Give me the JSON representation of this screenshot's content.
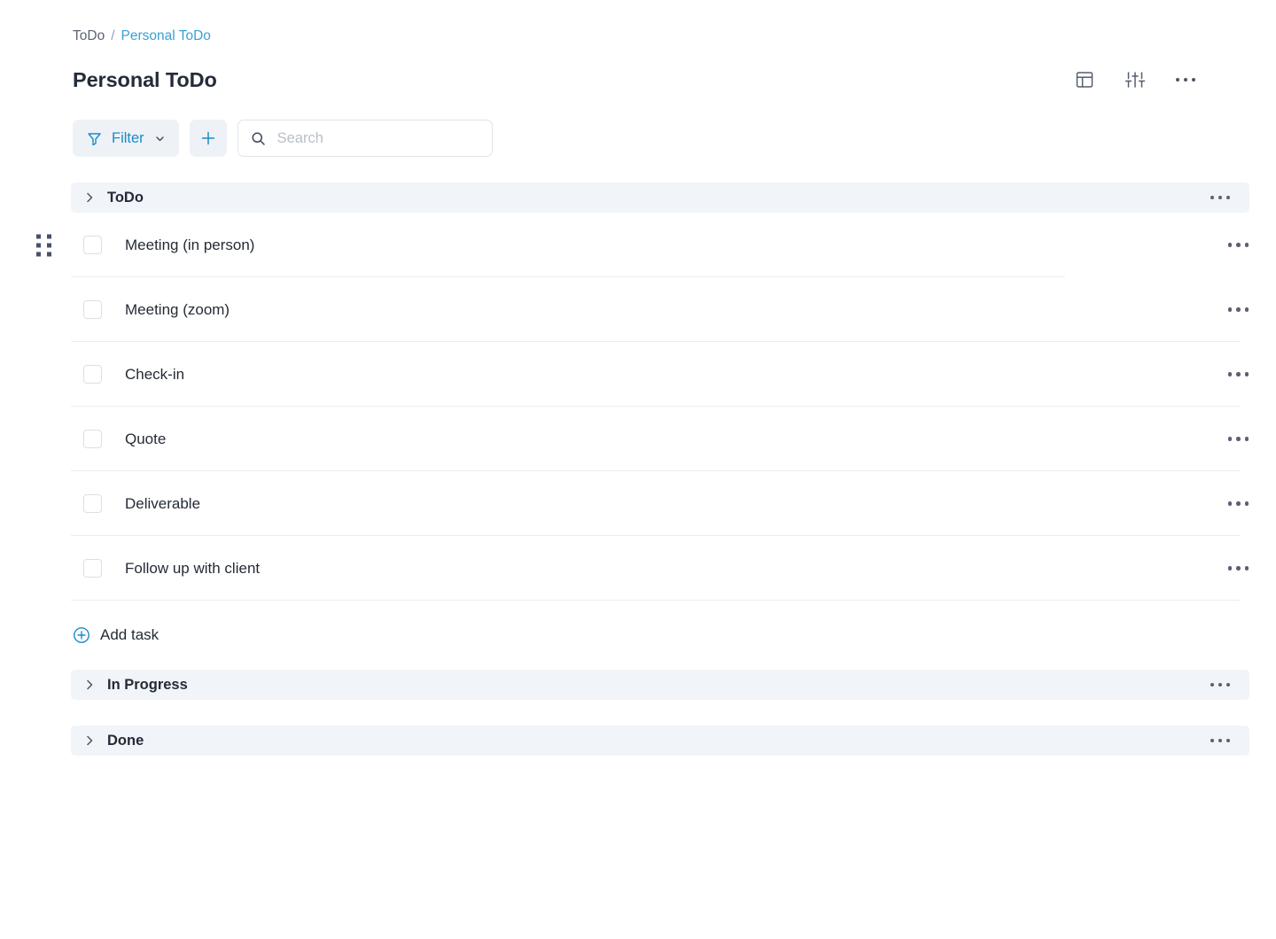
{
  "breadcrumb": {
    "root": "ToDo",
    "separator": "/",
    "current": "Personal ToDo"
  },
  "header": {
    "title": "Personal ToDo",
    "actions": [
      {
        "name": "layout-icon",
        "label": "Layout"
      },
      {
        "name": "settings-sliders-icon",
        "label": "Settings"
      },
      {
        "name": "more-horizontal-icon",
        "label": "More"
      }
    ]
  },
  "toolbar": {
    "filter_label": "Filter",
    "filter_icon": "funnel-icon",
    "filter_chevron_icon": "chevron-down-icon",
    "add_icon": "plus-icon",
    "search": {
      "icon": "search-icon",
      "value": "",
      "placeholder": "Search"
    }
  },
  "board": {
    "groups": [
      {
        "title": "ToDo",
        "collapsed": false,
        "tasks": [
          {
            "name": "Meeting (in person)",
            "checked": false
          },
          {
            "name": "Meeting (zoom)",
            "checked": false
          },
          {
            "name": "Check-in",
            "checked": false
          },
          {
            "name": "Quote",
            "checked": false
          },
          {
            "name": "Deliverable",
            "checked": false
          },
          {
            "name": "Follow up with client",
            "checked": false
          }
        ],
        "add_task_label": "Add task"
      },
      {
        "title": "In Progress",
        "collapsed": true,
        "tasks": []
      },
      {
        "title": "Done",
        "collapsed": true,
        "tasks": []
      }
    ]
  },
  "colors": {
    "accent_blue": "#1a8bc7",
    "link_blue": "#3a9fd4",
    "group_header_bg": "#f1f4f8",
    "control_bg": "#eef2f7",
    "text": "#242b37",
    "divider": "#ebedf0"
  }
}
